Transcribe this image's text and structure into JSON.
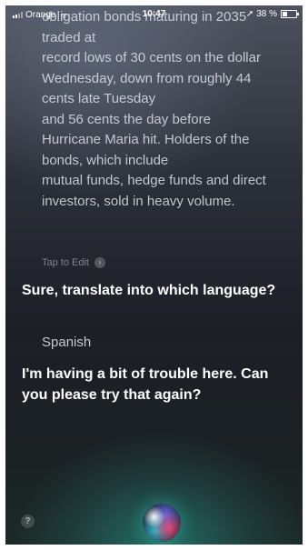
{
  "status_bar": {
    "carrier": "Orange",
    "time": "10:47",
    "battery_text": "38 %",
    "battery_level_percent": 38
  },
  "transcript": {
    "lines": [
      "obligation bonds maturing in 2035",
      "traded at",
      "record lows of 30 cents on the dollar",
      "Wednesday, down from roughly 44",
      "cents late Tuesday",
      "and 56 cents the day before",
      "Hurricane Maria hit. Holders of the",
      "bonds, which include",
      "mutual funds, hedge funds and direct",
      "investors, sold in heavy volume."
    ],
    "tap_to_edit": "Tap to Edit"
  },
  "conversation": {
    "siri_prompt": "Sure, translate into which language?",
    "user_reply": "Spanish",
    "siri_error": "I'm having a bit of trouble here. Can you please try that again?"
  },
  "help": {
    "label": "?"
  },
  "icons": {
    "tap_chevron": "›",
    "wifi": "ᯤ",
    "location": "➚"
  },
  "colors": {
    "text_primary": "#ffffff",
    "text_secondary": "#e1e4eb",
    "orb_cyan": "#3cc8dc",
    "orb_pink": "#ff4678",
    "orb_violet": "#786eff"
  }
}
